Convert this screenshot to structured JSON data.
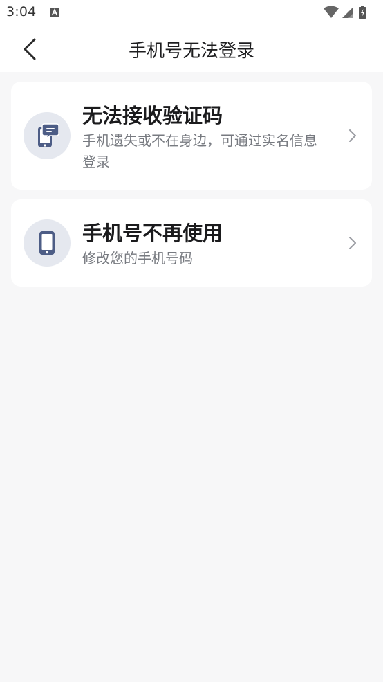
{
  "status_bar": {
    "time": "3:04",
    "icons": [
      "a-notification-icon",
      "wifi-icon",
      "cell-signal-icon",
      "battery-charging-icon"
    ]
  },
  "header": {
    "title": "手机号无法登录",
    "back_icon": "back-arrow-icon"
  },
  "options": [
    {
      "icon": "phone-message-icon",
      "title": "无法接收验证码",
      "description": "手机遗失或不在身边，可通过实名信息登录"
    },
    {
      "icon": "phone-icon",
      "title": "手机号不再使用",
      "description": "修改您的手机号码"
    }
  ],
  "colors": {
    "background": "#f7f7f8",
    "card": "#ffffff",
    "icon_circle": "#e5e8ef",
    "icon_accent": "#4d5d86",
    "title_text": "#1b1b1d",
    "desc_text": "#777a80"
  }
}
